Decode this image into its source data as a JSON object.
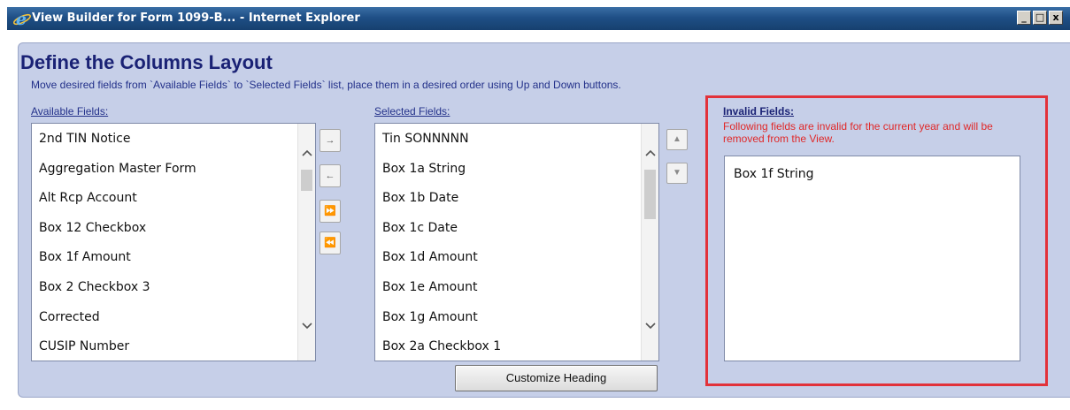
{
  "window": {
    "title": "View Builder for Form 1099-B... - Internet Explorer",
    "buttons": {
      "minimize": "_",
      "maximize": "□",
      "close": "x"
    }
  },
  "page": {
    "heading": "Define the Columns Layout",
    "instructions": "Move desired fields from `Available Fields` to `Selected Fields` list, place them in a desired order using Up and Down buttons."
  },
  "available": {
    "label": "Available Fields:",
    "items": [
      "2nd TIN Notice",
      "Aggregation Master Form",
      "Alt Rcp Account",
      "Box 12 Checkbox",
      "Box 1f Amount",
      "Box 2 Checkbox 3",
      "Corrected",
      "CUSIP Number"
    ]
  },
  "transfer_buttons": {
    "add": "→",
    "remove": "←",
    "add_all": "⏩",
    "remove_all": "⏪"
  },
  "selected": {
    "label": "Selected Fields:",
    "items": [
      "Tin SONNNNN",
      "Box 1a String",
      "Box 1b Date",
      "Box 1c Date",
      "Box 1d Amount",
      "Box 1e Amount",
      "Box 1g Amount",
      "Box 2a Checkbox 1"
    ],
    "up": "▲",
    "down": "▼"
  },
  "invalid": {
    "label": "Invalid Fields:",
    "message": "Following fields are invalid for the current year and will be removed from the View.",
    "items": [
      "Box 1f String"
    ]
  },
  "customize_button": "Customize Heading",
  "colors": {
    "titlebar": "#1f4f86",
    "panel": "#c6cfe8",
    "heading": "#1a2275",
    "invalid_border": "#e2323a",
    "invalid_text": "#e02828"
  }
}
